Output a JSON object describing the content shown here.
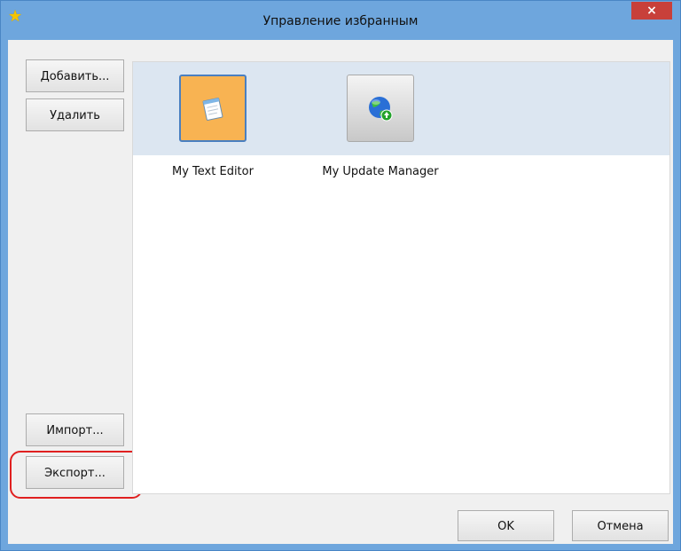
{
  "window": {
    "title": "Управление избранным",
    "close_glyph": "×",
    "star_glyph": "★"
  },
  "sidebar": {
    "add_label": "Добавить...",
    "remove_label": "Удалить",
    "import_label": "Импорт...",
    "export_label": "Экспорт..."
  },
  "favorites": [
    {
      "label": "My Text Editor",
      "icon": "notepad-icon",
      "selected": true
    },
    {
      "label": "My Update Manager",
      "icon": "globe-update-icon",
      "selected": false
    }
  ],
  "footer": {
    "ok_label": "OK",
    "cancel_label": "Отмена"
  },
  "colors": {
    "titlebar": "#6ea6dd",
    "selected_tile": "#f8b352",
    "highlight_ring": "#e02020"
  }
}
